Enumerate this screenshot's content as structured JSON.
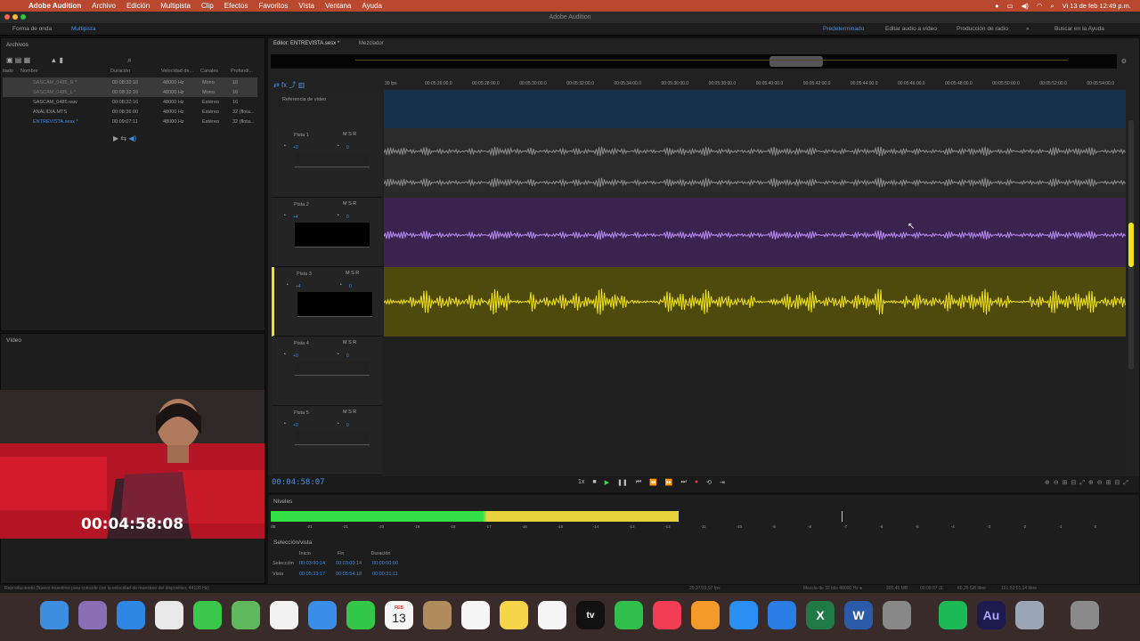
{
  "menubar": {
    "app": "Adobe Audition",
    "items": [
      "Archivo",
      "Edición",
      "Multipista",
      "Clip",
      "Efectos",
      "Favoritos",
      "Vista",
      "Ventana",
      "Ayuda"
    ],
    "datetime": "Vi 13 de feb  12:49 p.m."
  },
  "window_title": "Adobe Audition",
  "toolbar": {
    "waveform": "Forma de onda",
    "multitrack": "Multipista",
    "workspaces": [
      "Predeterminado",
      "Editar audio a vídeo",
      "Producción de radio"
    ],
    "help_search": "Buscar en la Ayuda"
  },
  "files": {
    "title": "Archivos",
    "columns": [
      "itado",
      "Nombre",
      "Duración",
      "Velocidad de...",
      "Canales",
      "Profundi..."
    ],
    "rows": [
      {
        "name": "SASCAM_0485_R *",
        "dur": "00:08:32:16",
        "rate": "48000 Hz",
        "ch": "Mono",
        "bits": "16",
        "sel": true
      },
      {
        "name": "SASCAM_0485_L *",
        "dur": "00:08:32:16",
        "rate": "48000 Hz",
        "ch": "Mono",
        "bits": "16",
        "sel": true
      },
      {
        "name": "SASCAM_0485.wav",
        "dur": "00:08:32:16",
        "rate": "48000 Hz",
        "ch": "Estéreo",
        "bits": "16",
        "sel": false
      },
      {
        "name": "ANALIDIA.MTS",
        "dur": "00:08:36:00",
        "rate": "48000 Hz",
        "ch": "Estéreo",
        "bits": "32 (flota...",
        "sel": false
      },
      {
        "name": "ENTREVISTA.sesx *",
        "dur": "00:09:07:11",
        "rate": "48000 Hz",
        "ch": "Estéreo",
        "bits": "32 (flota...",
        "sel": false
      }
    ]
  },
  "video": {
    "title": "Vídeo",
    "timecode": "00:04:58:08"
  },
  "editor": {
    "tab": "Editor: ENTREVISTA.sesx *",
    "mixer_tab": "Mezclador",
    "fps": "30 fps",
    "ruler": [
      "00:05:26:00.0",
      "00:05:28:00.0",
      "00:05:30:00.0",
      "00:05:32:00.0",
      "00:05:34:00.0",
      "00:05:36:00.0",
      "00:05:38:00.0",
      "00:05:40:00.0",
      "00:05:42:00.0",
      "00:05:44:00.0",
      "00:05:46:00.0",
      "00:05:48:00.0",
      "00:05:50:00.0",
      "00:05:52:00.0",
      "00:05:54:00.0"
    ],
    "video_ref": "Referencia de vídeo",
    "tracks": [
      {
        "name": "Pista 1",
        "vol": "+0",
        "pan": "0",
        "color": "#8a8a8a",
        "bg": "#2a2a2a"
      },
      {
        "name": "Pista 2",
        "vol": "+4",
        "pan": "0",
        "color": "#b58af0",
        "bg": "#3b2350"
      },
      {
        "name": "Pista 3",
        "vol": "+4",
        "pan": "0",
        "color": "#f2e21a",
        "bg": "#4e4a0e"
      },
      {
        "name": "Pista 4",
        "vol": "+0",
        "pan": "0",
        "color": "#555",
        "bg": "#1f1f1f"
      },
      {
        "name": "Pista 5",
        "vol": "+0",
        "pan": "0",
        "color": "#555",
        "bg": "#1f1f1f"
      }
    ],
    "time": "00:04:58:07",
    "speed": "1x"
  },
  "levels": {
    "title": "Niveles",
    "ticks": [
      "dB",
      "-21",
      "-21",
      "-20",
      "-19",
      "-18",
      "-17",
      "-16",
      "-15",
      "-14",
      "-13",
      "-12",
      "-11",
      "-10",
      "-9",
      "-8",
      "-7",
      "-6",
      "-5",
      "-4",
      "-3",
      "-2",
      "-1",
      "0"
    ]
  },
  "selview": {
    "title": "Selección/vista",
    "cols": [
      "Inicio",
      "Fin",
      "Duración"
    ],
    "rows": [
      {
        "label": "Selección",
        "start": "00:03:00:14",
        "end": "00:03:00:14",
        "dur": "00:00:00:00"
      },
      {
        "label": "Vista",
        "start": "00:05:23:17",
        "end": "00:05:54:18",
        "dur": "00:00:31:11"
      }
    ]
  },
  "status": {
    "left": "Reproduciendo (Nuevo muestreo para coincidir con la velocidad de muestreo del dispositivo: 44100 Hz)",
    "fps": "29,97/29,97 fps",
    "mix": "Mezcla de 32 bits 48000 Hz ●",
    "mem": "205,45 MB",
    "dur": "00:09:07:11",
    "free": "60,26 GB libre",
    "time": "101:53:51,14 libre"
  },
  "dock": {
    "calendar_month": "FEB",
    "calendar_day": "13",
    "apps": [
      "finder-icon",
      "launchpad-icon",
      "safari-icon",
      "chrome-icon",
      "messages-icon",
      "maps-icon",
      "photos-icon",
      "mail-icon",
      "facetime-icon",
      "calendar-icon",
      "contacts-icon",
      "reminders-icon",
      "notes-icon",
      "freeform-icon",
      "appletv-icon",
      "numbers-icon",
      "music-icon",
      "pages-icon",
      "appstore-icon",
      "keynote-icon",
      "excel-icon",
      "word-icon",
      "settings-icon",
      "spotify-icon",
      "audition-icon",
      "quicktime-icon",
      "trash-icon"
    ]
  }
}
